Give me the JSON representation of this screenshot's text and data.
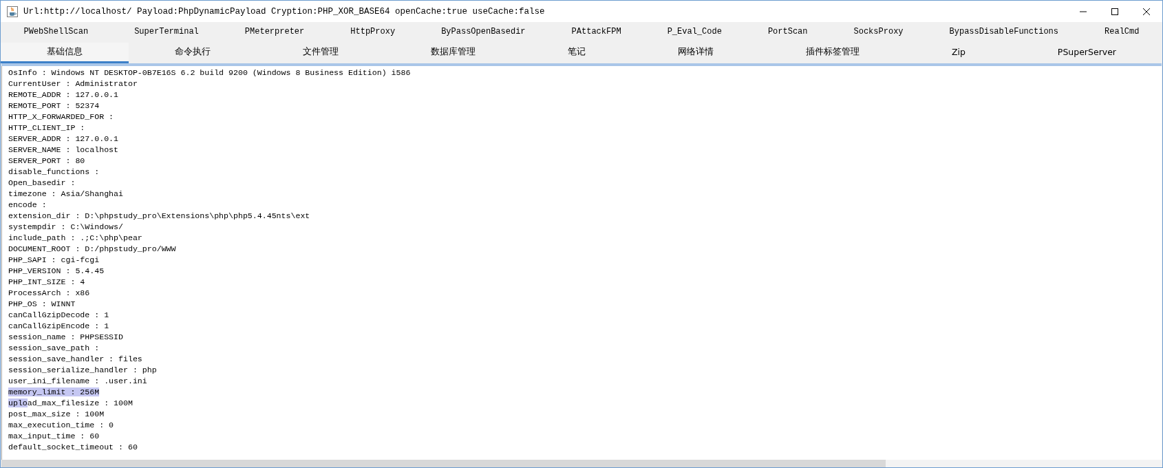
{
  "window": {
    "title": "Url:http://localhost/ Payload:PhpDynamicPayload Cryption:PHP_XOR_BASE64 openCache:true useCache:false"
  },
  "plugin_tabs": [
    {
      "label": "PWebShellScan",
      "selected": false
    },
    {
      "label": "SuperTerminal",
      "selected": false
    },
    {
      "label": "PMeterpreter",
      "selected": false
    },
    {
      "label": "HttpProxy",
      "selected": false
    },
    {
      "label": "ByPassOpenBasedir",
      "selected": false
    },
    {
      "label": "PAttackFPM",
      "selected": false
    },
    {
      "label": "P_Eval_Code",
      "selected": false
    },
    {
      "label": "PortScan",
      "selected": false
    },
    {
      "label": "SocksProxy",
      "selected": false
    },
    {
      "label": "BypassDisableFunctions",
      "selected": false
    },
    {
      "label": "RealCmd",
      "selected": false
    }
  ],
  "main_tabs": [
    {
      "label": "基础信息",
      "selected": true
    },
    {
      "label": "命令执行",
      "selected": false
    },
    {
      "label": "文件管理",
      "selected": false
    },
    {
      "label": "数据库管理",
      "selected": false
    },
    {
      "label": "笔记",
      "selected": false
    },
    {
      "label": "网络详情",
      "selected": false
    },
    {
      "label": "插件标签管理",
      "selected": false
    },
    {
      "label": "Zip",
      "selected": false
    },
    {
      "label": "PSuperServer",
      "selected": false
    }
  ],
  "info_lines": [
    {
      "text": "OsInfo : Windows NT DESKTOP-0B7E16S 6.2 build 9200 (Windows 8 Business Edition) i586",
      "selected": false
    },
    {
      "text": "CurrentUser : Administrator",
      "selected": false
    },
    {
      "text": "REMOTE_ADDR : 127.0.0.1",
      "selected": false
    },
    {
      "text": "REMOTE_PORT : 52374",
      "selected": false
    },
    {
      "text": "HTTP_X_FORWARDED_FOR :",
      "selected": false
    },
    {
      "text": "HTTP_CLIENT_IP :",
      "selected": false
    },
    {
      "text": "SERVER_ADDR : 127.0.0.1",
      "selected": false
    },
    {
      "text": "SERVER_NAME : localhost",
      "selected": false
    },
    {
      "text": "SERVER_PORT : 80",
      "selected": false
    },
    {
      "text": "disable_functions :",
      "selected": false
    },
    {
      "text": "Open_basedir :",
      "selected": false
    },
    {
      "text": "timezone : Asia/Shanghai",
      "selected": false
    },
    {
      "text": "encode :",
      "selected": false
    },
    {
      "text": "extension_dir : D:\\phpstudy_pro\\Extensions\\php\\php5.4.45nts\\ext",
      "selected": false
    },
    {
      "text": "systempdir : C:\\Windows/",
      "selected": false
    },
    {
      "text": "include_path : .;C:\\php\\pear",
      "selected": false
    },
    {
      "text": "DOCUMENT_ROOT : D:/phpstudy_pro/WWW",
      "selected": false
    },
    {
      "text": "PHP_SAPI : cgi-fcgi",
      "selected": false
    },
    {
      "text": "PHP_VERSION : 5.4.45",
      "selected": false
    },
    {
      "text": "PHP_INT_SIZE : 4",
      "selected": false
    },
    {
      "text": "ProcessArch : x86",
      "selected": false
    },
    {
      "text": "PHP_OS : WINNT",
      "selected": false
    },
    {
      "text": "canCallGzipDecode : 1",
      "selected": false
    },
    {
      "text": "canCallGzipEncode : 1",
      "selected": false
    },
    {
      "text": "session_name : PHPSESSID",
      "selected": false
    },
    {
      "text": "session_save_path :",
      "selected": false
    },
    {
      "text": "session_save_handler : files",
      "selected": false
    },
    {
      "text": "session_serialize_handler : php",
      "selected": false
    },
    {
      "text": "user_ini_filename : .user.ini",
      "selected": false
    },
    {
      "text": "memory_limit : 256M",
      "selected": true
    },
    {
      "segments": [
        {
          "text": "uplo",
          "selected": true
        },
        {
          "text": "ad_max_filesize : 100M",
          "selected": false
        }
      ]
    },
    {
      "text": "post_max_size : 100M",
      "selected": false
    },
    {
      "text": "max_execution_time : 0",
      "selected": false
    },
    {
      "text": "max_input_time : 60",
      "selected": false
    },
    {
      "text": "default_socket_timeout : 60",
      "selected": false
    }
  ]
}
